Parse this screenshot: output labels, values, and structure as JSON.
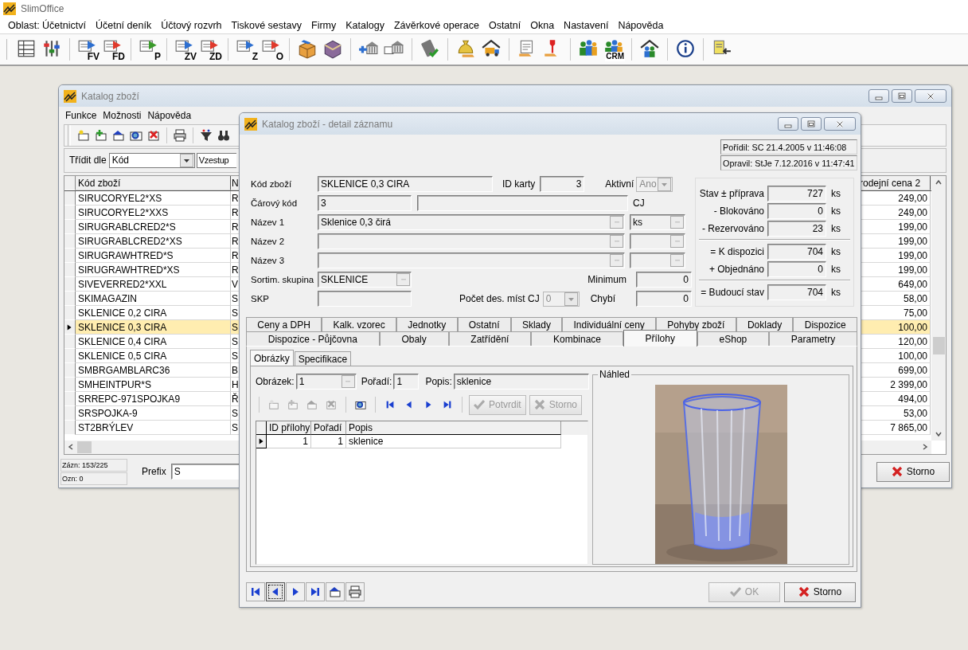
{
  "app": {
    "title": "SlimOffice",
    "menu": [
      "Oblast: Účetnictví",
      "Účetní deník",
      "Účtový rozvrh",
      "Tiskové sestavy",
      "Firmy",
      "Katalogy",
      "Závěrkové operace",
      "Ostatní",
      "Okna",
      "Nastavení",
      "Nápověda"
    ],
    "toolbar": [
      [
        {
          "kind": "grid"
        },
        {
          "kind": "sliders"
        }
      ],
      [
        {
          "kind": "doc-blue",
          "caption": "FV"
        },
        {
          "kind": "doc-red",
          "caption": "FD"
        }
      ],
      [
        {
          "kind": "doc-green",
          "caption": "P"
        }
      ],
      [
        {
          "kind": "doc-blue",
          "caption": "ZV"
        },
        {
          "kind": "doc-red",
          "caption": "ZD"
        }
      ],
      [
        {
          "kind": "doc-blue",
          "caption": "Z"
        },
        {
          "kind": "doc-red",
          "caption": "O"
        }
      ],
      [
        {
          "kind": "box"
        },
        {
          "kind": "book"
        }
      ],
      [
        {
          "kind": "bank-arrow"
        },
        {
          "kind": "bank"
        }
      ],
      [
        {
          "kind": "calculator"
        }
      ],
      [
        {
          "kind": "money-bag"
        },
        {
          "kind": "truck-house"
        }
      ],
      [
        {
          "kind": "receipt"
        },
        {
          "kind": "wrench"
        }
      ],
      [
        {
          "kind": "people"
        },
        {
          "kind": "people",
          "caption": "CRM"
        }
      ],
      [
        {
          "kind": "house-people"
        }
      ],
      [
        {
          "kind": "info"
        }
      ],
      [
        {
          "kind": "exit"
        }
      ]
    ]
  },
  "back_window": {
    "title": "Katalog zboží",
    "menu": [
      "Funkce",
      "Možnosti",
      "Nápověda"
    ],
    "tools": [
      [
        {
          "kind": "new"
        },
        {
          "kind": "add"
        },
        {
          "kind": "up"
        },
        {
          "kind": "search"
        },
        {
          "kind": "delete"
        }
      ],
      [
        {
          "kind": "print"
        }
      ],
      [
        {
          "kind": "filter"
        },
        {
          "kind": "binoculars"
        }
      ]
    ],
    "sort_label": "Třídit dle",
    "sort_value": "Kód",
    "order_value": "Vzestup",
    "columns": [
      "Kód zboží",
      "N",
      "rodejní cena 2"
    ],
    "rows": [
      {
        "code": "SIRUCORYEL2*XS",
        "column_2": "R",
        "price": "249,00",
        "selected": false
      },
      {
        "code": "SIRUCORYEL2*XXS",
        "column_2": "R",
        "price": "249,00",
        "selected": false
      },
      {
        "code": "SIRUGRABLCRED2*S",
        "column_2": "R",
        "price": "199,00",
        "selected": false
      },
      {
        "code": "SIRUGRABLCRED2*XS",
        "column_2": "R",
        "price": "199,00",
        "selected": false
      },
      {
        "code": "SIRUGRAWHTRED*S",
        "column_2": "R",
        "price": "199,00",
        "selected": false
      },
      {
        "code": "SIRUGRAWHTRED*XS",
        "column_2": "R",
        "price": "199,00",
        "selected": false
      },
      {
        "code": "SIVEVERRED2*XXL",
        "column_2": "V",
        "price": "649,00",
        "selected": false
      },
      {
        "code": "SKIMAGAZIN",
        "column_2": "S",
        "price": "58,00",
        "selected": false
      },
      {
        "code": "SKLENICE 0,2 CIRA",
        "column_2": "S",
        "price": "75,00",
        "selected": false
      },
      {
        "code": "SKLENICE 0,3 CIRA",
        "column_2": "S",
        "price": "100,00",
        "selected": true
      },
      {
        "code": "SKLENICE 0,4 CIRA",
        "column_2": "S",
        "price": "120,00",
        "selected": false
      },
      {
        "code": "SKLENICE 0,5 CIRA",
        "column_2": "S",
        "price": "100,00",
        "selected": false
      },
      {
        "code": "SMBRGAMBLARC36",
        "column_2": "B",
        "price": "699,00",
        "selected": false
      },
      {
        "code": "SMHEINTPUR*S",
        "column_2": "H",
        "price": "2 399,00",
        "selected": false
      },
      {
        "code": "SRREPC-971SPOJKA9",
        "column_2": "Ř",
        "price": "494,00",
        "selected": false
      },
      {
        "code": "SRSPOJKA-9",
        "column_2": "S",
        "price": "53,00",
        "selected": false
      },
      {
        "code": "ST2BRÝLEV",
        "column_2": "S",
        "price": "7 865,00",
        "selected": false
      }
    ],
    "records": "Zázn: 153/225",
    "marked": "Ozn: 0",
    "prefix_label": "Prefix",
    "prefix_value": "S",
    "cancel": "Storno"
  },
  "detail": {
    "title": "Katalog zboží - detail záznamu",
    "created": "Pořídil: SC 21.4.2005 v 11:46:08",
    "modified": "Opravil: StJe 7.12.2016 v 11:47:41",
    "code_label": "Kód zboží",
    "code": "SKLENICE 0,3 CIRA",
    "id_label": "ID karty",
    "id": "3",
    "active_label": "Aktivní",
    "active": "Ano",
    "barcode_label": "Čárový kód",
    "barcode": "3",
    "unit_label": "CJ",
    "names": [
      {
        "label": "Název 1",
        "value": "Sklenice 0,3 čirá",
        "unit": "ks"
      },
      {
        "label": "Název 2"
      },
      {
        "label": "Název 3"
      }
    ],
    "group_label": "Sortim. skupina",
    "group": "SKLENICE",
    "skp_label": "SKP",
    "decimals_label": "Počet des. míst CJ",
    "decimals": "0",
    "minimum_label": "Minimum",
    "minimum": "0",
    "missing_label": "Chybí",
    "missing": "0",
    "stock": [
      {
        "kind": "item",
        "label": "Stav ± příprava",
        "value": "727",
        "unit": "ks"
      },
      {
        "kind": "item",
        "label": "- Blokováno",
        "value": "0",
        "unit": "ks"
      },
      {
        "kind": "item",
        "label": "- Rezervováno",
        "value": "23",
        "unit": "ks"
      },
      {
        "kind": "total",
        "label": "= K dispozici",
        "value": "704",
        "unit": "ks"
      },
      {
        "kind": "item",
        "label": "+ Objednáno",
        "value": "0",
        "unit": "ks"
      },
      {
        "kind": "total",
        "label": "= Budoucí stav",
        "value": "704",
        "unit": "ks"
      }
    ],
    "tabs_row_1": [
      {
        "label": "Ceny a DPH",
        "selected": false
      },
      {
        "label": "Kalk. vzorec",
        "selected": false
      },
      {
        "label": "Jednotky",
        "selected": false
      },
      {
        "label": "Ostatní",
        "selected": false
      },
      {
        "label": "Sklady",
        "selected": false
      },
      {
        "label": "Individuální ceny",
        "selected": false
      },
      {
        "label": "Pohyby zboží",
        "selected": false
      },
      {
        "label": "Doklady",
        "selected": false
      },
      {
        "label": "Dispozice",
        "selected": false
      }
    ],
    "tabs_row_2": [
      {
        "label": "Dispozice - Půjčovna",
        "selected": false
      },
      {
        "label": "Obaly",
        "selected": false
      },
      {
        "label": "Zatřídění",
        "selected": false
      },
      {
        "label": "Kombinace",
        "selected": false
      },
      {
        "label": "Přílohy",
        "selected": true
      },
      {
        "label": "eShop",
        "selected": false
      },
      {
        "label": "Parametry",
        "selected": false
      }
    ],
    "subtabs": [
      {
        "label": "Obrázky",
        "selected": true
      },
      {
        "label": "Specifikace",
        "selected": false
      }
    ],
    "attachment": {
      "image_label": "Obrázek:",
      "image": "1",
      "order_label": "Pořadí:",
      "order": "1",
      "desc_label": "Popis:",
      "desc": "sklenice",
      "tools": [
        [
          {
            "kind": "new",
            "disabled": true
          },
          {
            "kind": "add",
            "disabled": true
          },
          {
            "kind": "up",
            "disabled": true
          },
          {
            "kind": "delete",
            "disabled": true
          }
        ],
        [
          {
            "kind": "search",
            "disabled": false
          }
        ],
        [
          {
            "kind": "first",
            "disabled": false
          },
          {
            "kind": "prev",
            "disabled": false
          },
          {
            "kind": "next",
            "disabled": false
          },
          {
            "kind": "last",
            "disabled": false
          }
        ]
      ],
      "confirm": {
        "label": "Potvrdit",
        "disabled": true
      },
      "cancel": {
        "label": "Storno",
        "disabled": true
      },
      "columns": [
        "ID přílohy",
        "Pořadí",
        "Popis"
      ],
      "rows": [
        {
          "id": "1",
          "order": "1",
          "desc": "sklenice",
          "selected": true
        }
      ],
      "preview_label": "Náhled",
      "preview": {
        "kind": "picture"
      }
    },
    "nav": [
      {
        "kind": "first",
        "focused": false
      },
      {
        "kind": "prev",
        "focused": true
      },
      {
        "kind": "next",
        "focused": false
      },
      {
        "kind": "last",
        "focused": false
      },
      {
        "kind": "up",
        "focused": false
      },
      {
        "kind": "print",
        "focused": false
      }
    ],
    "ok": {
      "label": "OK",
      "disabled": true
    },
    "cancel": {
      "label": "Storno",
      "disabled": false
    }
  }
}
